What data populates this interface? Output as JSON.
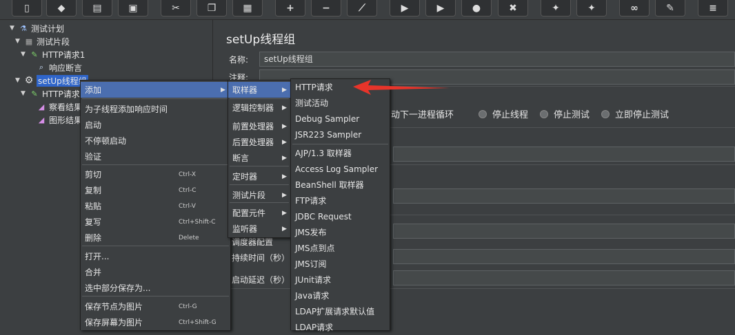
{
  "toolbar": {
    "buttons": [
      {
        "icon": "new-icon",
        "glyph": "▯"
      },
      {
        "icon": "templates-icon",
        "glyph": "◆"
      },
      {
        "icon": "open-icon",
        "glyph": "▤"
      },
      {
        "icon": "save-icon",
        "glyph": "▣"
      },
      {
        "icon": "cut-icon",
        "glyph": "✂"
      },
      {
        "icon": "copy-icon",
        "glyph": "❐"
      },
      {
        "icon": "paste-icon",
        "glyph": "▦"
      },
      {
        "icon": "expand-icon",
        "glyph": "+"
      },
      {
        "icon": "collapse-icon",
        "glyph": "−"
      },
      {
        "icon": "toggle-icon",
        "glyph": "⟋"
      },
      {
        "icon": "start-icon",
        "glyph": "▶"
      },
      {
        "icon": "start-no-pause-icon",
        "glyph": "▶"
      },
      {
        "icon": "stop-icon",
        "glyph": "●"
      },
      {
        "icon": "shutdown-icon",
        "glyph": "✖"
      },
      {
        "icon": "clear-icon",
        "glyph": "✦"
      },
      {
        "icon": "clear-all-icon",
        "glyph": "✦"
      },
      {
        "icon": "search-icon",
        "glyph": "∞"
      },
      {
        "icon": "reset-search-icon",
        "glyph": "✎"
      },
      {
        "icon": "function-helper-icon",
        "glyph": "≡"
      }
    ]
  },
  "tree": {
    "nodes": [
      {
        "label": "测试计划",
        "icon": "test-plan-icon",
        "glyph": "⚗"
      },
      {
        "label": "测试片段",
        "icon": "test-fragment-icon",
        "glyph": "▦"
      },
      {
        "label": "HTTP请求1",
        "icon": "sampler-icon",
        "glyph": "✎"
      },
      {
        "label": "响应断言",
        "icon": "assertion-icon",
        "glyph": "🔍"
      },
      {
        "label": "setUp线程组",
        "icon": "thread-group-icon",
        "glyph": "⚙"
      },
      {
        "label": "HTTP请求",
        "icon": "sampler-icon",
        "glyph": "✎"
      },
      {
        "label": "察看结果",
        "icon": "listener-icon",
        "glyph": "◢"
      },
      {
        "label": "图形结果",
        "icon": "listener-icon",
        "glyph": "◢"
      }
    ]
  },
  "panel": {
    "title": "setUp线程组",
    "name_label": "名称:",
    "name_value": "setUp线程组",
    "comment_label": "注释:",
    "radios": [
      "启动下一进程循环",
      "停止线程",
      "停止测试",
      "立即停止测试"
    ],
    "scheduler_label": "调度器配置",
    "duration_label": "持续时间（秒）",
    "delay_label": "启动延迟（秒）"
  },
  "context_menu": {
    "items": [
      {
        "label": "添加",
        "shortcut": "",
        "submenu": true
      },
      {
        "label": "为子线程添加响应时间",
        "shortcut": "",
        "submenu": false
      },
      {
        "label": "启动",
        "shortcut": "",
        "submenu": false
      },
      {
        "label": "不停顿启动",
        "shortcut": "",
        "submenu": false
      },
      {
        "label": "验证",
        "shortcut": "",
        "submenu": false
      },
      {
        "label": "剪切",
        "shortcut": "Ctrl-X",
        "submenu": false
      },
      {
        "label": "复制",
        "shortcut": "Ctrl-C",
        "submenu": false
      },
      {
        "label": "粘贴",
        "shortcut": "Ctrl-V",
        "submenu": false
      },
      {
        "label": "复写",
        "shortcut": "Ctrl+Shift-C",
        "submenu": false
      },
      {
        "label": "删除",
        "shortcut": "Delete",
        "submenu": false
      },
      {
        "label": "打开...",
        "shortcut": "",
        "submenu": false
      },
      {
        "label": "合并",
        "shortcut": "",
        "submenu": false
      },
      {
        "label": "选中部分保存为...",
        "shortcut": "",
        "submenu": false
      },
      {
        "label": "保存节点为图片",
        "shortcut": "Ctrl-G",
        "submenu": false
      },
      {
        "label": "保存屏幕为图片",
        "shortcut": "Ctrl+Shift-G",
        "submenu": false
      }
    ]
  },
  "add_menu": {
    "items": [
      "取样器",
      "逻辑控制器",
      "前置处理器",
      "后置处理器",
      "断言",
      "定时器",
      "测试片段",
      "配置元件",
      "监听器"
    ]
  },
  "sampler_menu": {
    "items": [
      "HTTP请求",
      "测试活动",
      "Debug Sampler",
      "JSR223 Sampler",
      "AJP/1.3 取样器",
      "Access Log Sampler",
      "BeanShell 取样器",
      "FTP请求",
      "JDBC Request",
      "JMS发布",
      "JMS点到点",
      "JMS订阅",
      "JUnit请求",
      "Java请求",
      "LDAP扩展请求默认值",
      "LDAP请求"
    ]
  },
  "colors": {
    "menu_highlight": "#4b6eaf",
    "tree_selection": "#2f65ca",
    "annotation_arrow": "#e8342a"
  }
}
